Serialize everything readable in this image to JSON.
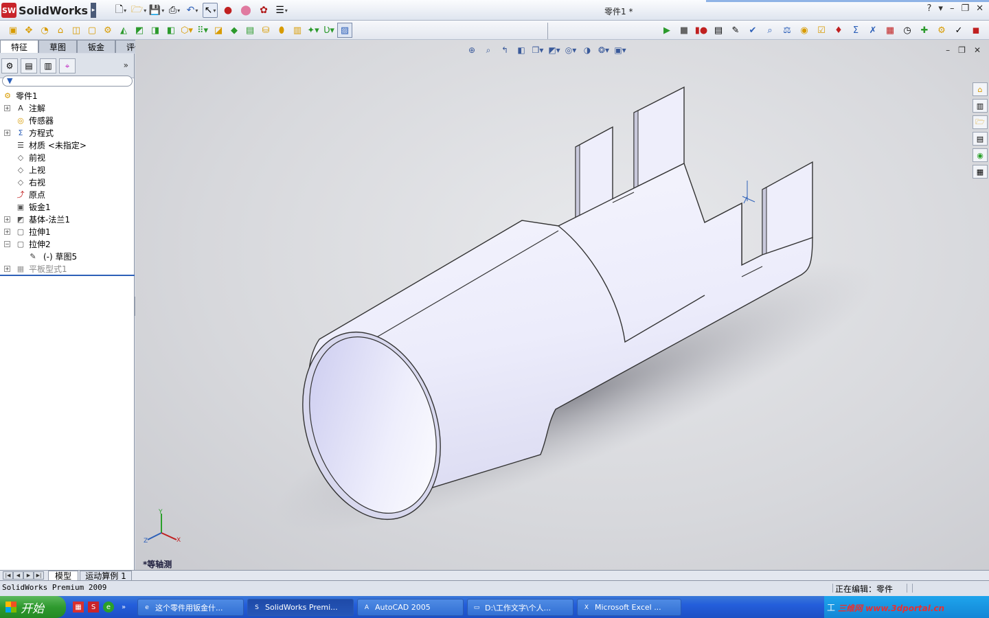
{
  "window": {
    "app_name": "SolidWorks",
    "doc_title": "零件1 *"
  },
  "tabs": [
    "特征",
    "草图",
    "钣金",
    "评估"
  ],
  "tree": {
    "root": "零件1",
    "items": [
      {
        "label": "注解",
        "expand": "+",
        "icon": "annotation-icon"
      },
      {
        "label": "传感器",
        "expand": "",
        "icon": "sensor-icon"
      },
      {
        "label": "方程式",
        "expand": "+",
        "icon": "equation-icon"
      },
      {
        "label": "材质 <未指定>",
        "expand": "",
        "icon": "material-icon"
      },
      {
        "label": "前视",
        "expand": "",
        "icon": "plane-icon"
      },
      {
        "label": "上视",
        "expand": "",
        "icon": "plane-icon"
      },
      {
        "label": "右视",
        "expand": "",
        "icon": "plane-icon"
      },
      {
        "label": "原点",
        "expand": "",
        "icon": "origin-icon"
      },
      {
        "label": "钣金1",
        "expand": "",
        "icon": "sheetmetal-icon"
      },
      {
        "label": "基体-法兰1",
        "expand": "+",
        "icon": "base-flange-icon"
      },
      {
        "label": "拉伸1",
        "expand": "+",
        "icon": "extrude-icon"
      },
      {
        "label": "拉伸2",
        "expand": "−",
        "icon": "extrude-icon"
      },
      {
        "label": "(-) 草图5",
        "expand": "",
        "icon": "sketch-icon"
      },
      {
        "label": "平板型式1",
        "expand": "+",
        "icon": "flat-pattern-icon",
        "greyed": true
      }
    ]
  },
  "viewport": {
    "view_label": "*等轴测"
  },
  "bottom_tabs": [
    "模型",
    "运动算例 1"
  ],
  "status": {
    "left": "SolidWorks Premium 2009",
    "right": "正在编辑：零件"
  },
  "taskbar": {
    "start": "开始",
    "items": [
      {
        "label": "这个零件用钣金什...",
        "icon": "browser-icon"
      },
      {
        "label": "SolidWorks Premi...",
        "icon": "solidworks-icon",
        "active": true
      },
      {
        "label": "AutoCAD 2005",
        "icon": "autocad-icon"
      },
      {
        "label": "D:\\工作文字\\个人...",
        "icon": "folder-icon"
      },
      {
        "label": "Microsoft Excel ...",
        "icon": "excel-icon"
      }
    ],
    "tray_text": "工",
    "watermark": "三维网 www.3dportal.cn"
  },
  "colors": {
    "accent": "#2c5fb8",
    "taskbar": "#245edb",
    "start": "#2f9a2f",
    "part": "#eeeefb"
  }
}
